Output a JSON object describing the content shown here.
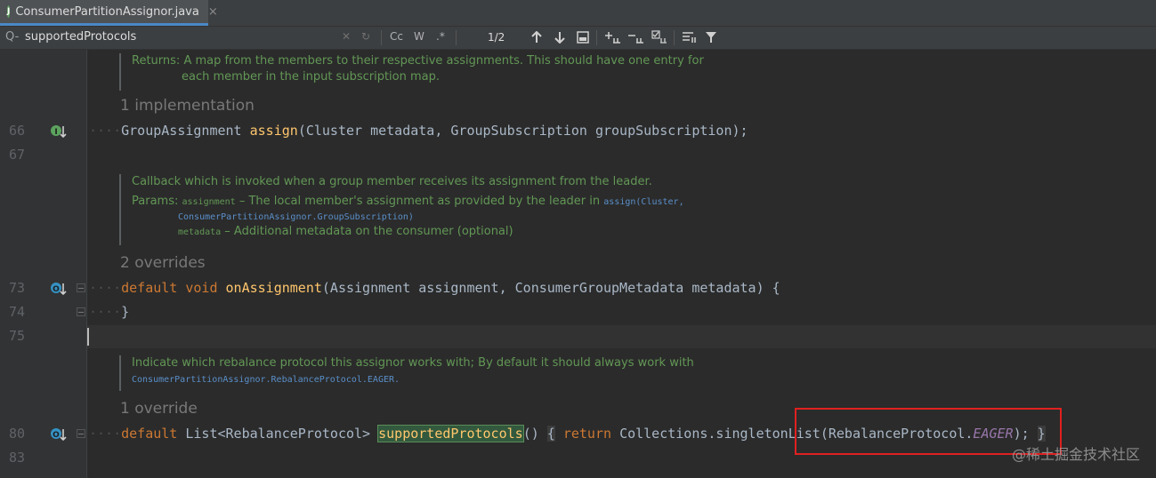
{
  "tab": {
    "file_name": "ConsumerPartitionAssignor.java",
    "close": "×",
    "badge": "J"
  },
  "search": {
    "icon": "Q-",
    "query": "supportedProtocols",
    "clear": "✕",
    "history": "↻",
    "match_case": "Cc",
    "words": "W",
    "regex": ".*",
    "result_count": "1/2",
    "icons": [
      "arrow-up-icon",
      "arrow-down-icon",
      "select-all-icon",
      "add-occurrence-icon",
      "remove-occurrence-icon",
      "select-occurrences-icon",
      "multiline-icon",
      "filter-icon"
    ]
  },
  "editor": {
    "line_numbers": {
      "l66": "66",
      "l67": "67",
      "l73": "73",
      "l74": "74",
      "l75": "75",
      "l80": "80",
      "l83": "83"
    },
    "doc1": {
      "returns_label": "Returns:",
      "returns_text": "A map from the members to their respective assignments. This should have one entry for",
      "returns_text2": "each member in the input subscription map."
    },
    "hint_66": "1 implementation",
    "line66": {
      "type": "GroupAssignment",
      "method": "assign",
      "params": "(Cluster metadata, GroupSubscription groupSubscription);"
    },
    "doc2": {
      "summary": "Callback which is invoked when a group member receives its assignment from the leader.",
      "params_label": "Params:",
      "p1_name": "assignment",
      "p1_text": " – The local member's assignment as provided by the leader in ",
      "p1_link": "assign(Cluster,",
      "p1_link2": "ConsumerPartitionAssignor.GroupSubscription)",
      "p2_name": "metadata",
      "p2_text": " – Additional metadata on the consumer (optional)"
    },
    "hint_73": "2 overrides",
    "line73": {
      "kw1": "default",
      "kw2": "void",
      "method": "onAssignment",
      "params": "(Assignment assignment, ConsumerGroupMetadata metadata)",
      "brace": "{"
    },
    "line74": {
      "brace": "}"
    },
    "doc3": {
      "summary": "Indicate which rebalance protocol this assignor works with; By default it should always work with",
      "link": "ConsumerPartitionAssignor.RebalanceProtocol.EAGER."
    },
    "hint_80": "1 override",
    "line80": {
      "kw": "default",
      "type": "List<RebalanceProtocol>",
      "method": "supportedProtocols",
      "parens": "()",
      "open": "{",
      "ret": "return",
      "call": "Collections.singletonList(RebalanceProtocol.",
      "field": "EAGER",
      "close": ");",
      "end": "}"
    }
  },
  "watermark": "@稀土掘金技术社区",
  "colors": {
    "background": "#2b2b2b",
    "gutter": "#313335",
    "keyword": "#cc7832",
    "method": "#ffc66d",
    "doc": "#629755",
    "highlight_box": "#e02020"
  }
}
